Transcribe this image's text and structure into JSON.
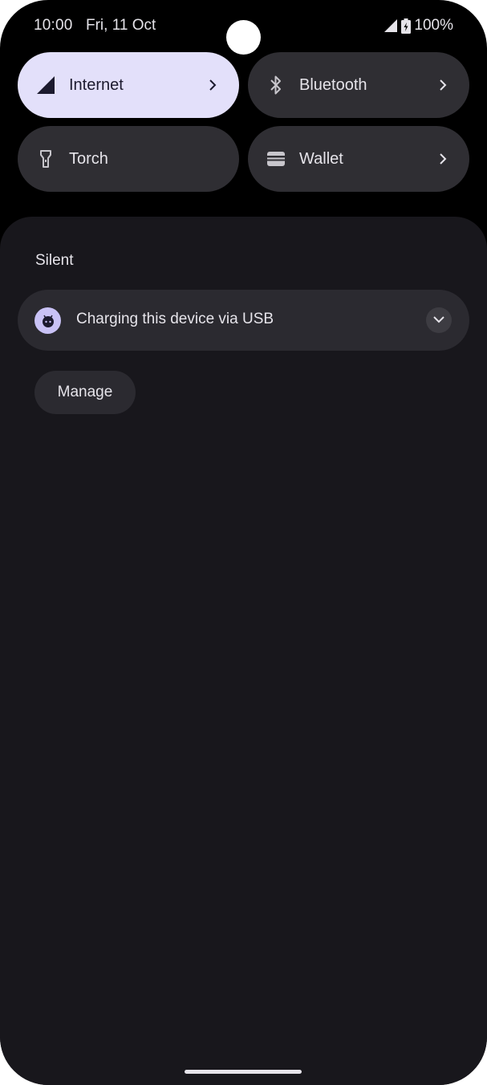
{
  "status_bar": {
    "time": "10:00",
    "date": "Fri, 11 Oct",
    "battery": "100%",
    "icons": [
      "signal-icon",
      "battery-charging-icon"
    ]
  },
  "quick_settings": {
    "tiles": [
      {
        "label": "Internet",
        "icon": "signal-icon",
        "active": true,
        "has_chevron": true
      },
      {
        "label": "Bluetooth",
        "icon": "bluetooth-icon",
        "active": false,
        "has_chevron": true
      },
      {
        "label": "Torch",
        "icon": "torch-icon",
        "active": false,
        "has_chevron": false
      },
      {
        "label": "Wallet",
        "icon": "wallet-icon",
        "active": false,
        "has_chevron": true
      }
    ]
  },
  "notifications": {
    "section_title": "Silent",
    "items": [
      {
        "title": "Charging this device via USB",
        "icon": "android-icon"
      }
    ],
    "manage_label": "Manage"
  },
  "colors": {
    "background": "#000000",
    "shade": "#18171c",
    "tile_inactive": "#2f2e33",
    "tile_active": "#e3e0fa",
    "card": "#2b2a30",
    "accent_icon": "#c9c2f6",
    "text_primary": "#e6e4ea"
  }
}
